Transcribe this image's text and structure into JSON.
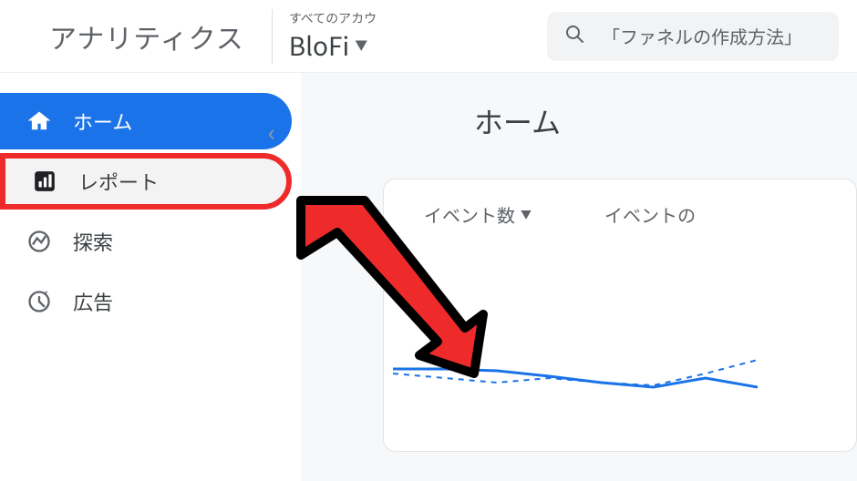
{
  "header": {
    "app_title": "アナリティクス",
    "account_label": "すべてのアカウ",
    "account_name": "BloFi",
    "search_text": "「ファネルの作成方法」"
  },
  "sidebar": {
    "items": [
      {
        "label": "ホーム"
      },
      {
        "label": "レポート"
      },
      {
        "label": "探索"
      },
      {
        "label": "広告"
      }
    ]
  },
  "main": {
    "page_title": "ホーム",
    "metric1": "イベント数",
    "metric2": "イベントの"
  },
  "chart_data": {
    "type": "line",
    "series": [
      {
        "name": "solid",
        "values": [
          60,
          60,
          58,
          52,
          45,
          40,
          50,
          40
        ]
      },
      {
        "name": "dashed",
        "values": [
          55,
          50,
          45,
          50,
          45,
          42,
          55,
          70
        ]
      }
    ],
    "ylim": [
      0,
      100
    ]
  }
}
